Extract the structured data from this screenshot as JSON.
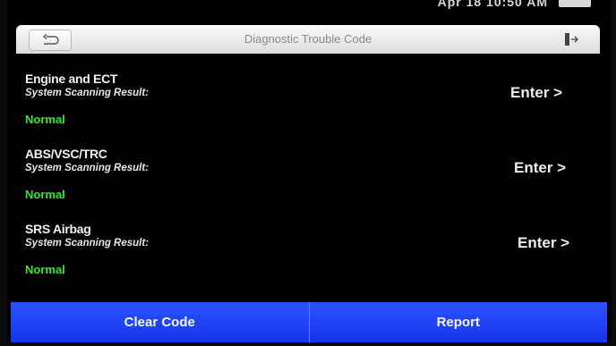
{
  "status_bar": {
    "text": "Apr 18  10:50 AM",
    "battery_color": "#d8d8d8"
  },
  "header": {
    "title": "Diagnostic Trouble Code",
    "back_icon": "back-arrow-icon",
    "exit_icon": "exit-icon"
  },
  "label_scan_result": "System Scanning Result:",
  "systems": [
    {
      "name": "Engine and ECT",
      "scan_label": "System Scanning Result:",
      "status": "Normal",
      "enter_label": "Enter >"
    },
    {
      "name": "ABS/VSC/TRC",
      "scan_label": "System Scanning Result:",
      "status": "Normal",
      "enter_label": "Enter >"
    },
    {
      "name": "SRS Airbag",
      "scan_label": "System Scanning Result:",
      "status": "Normal",
      "enter_label": "Enter >"
    }
  ],
  "bottom_bar": {
    "clear_label": "Clear Code",
    "report_label": "Report"
  },
  "colors": {
    "accent": "#1a3cf5",
    "status_ok": "#33e63a",
    "background": "#000000"
  }
}
